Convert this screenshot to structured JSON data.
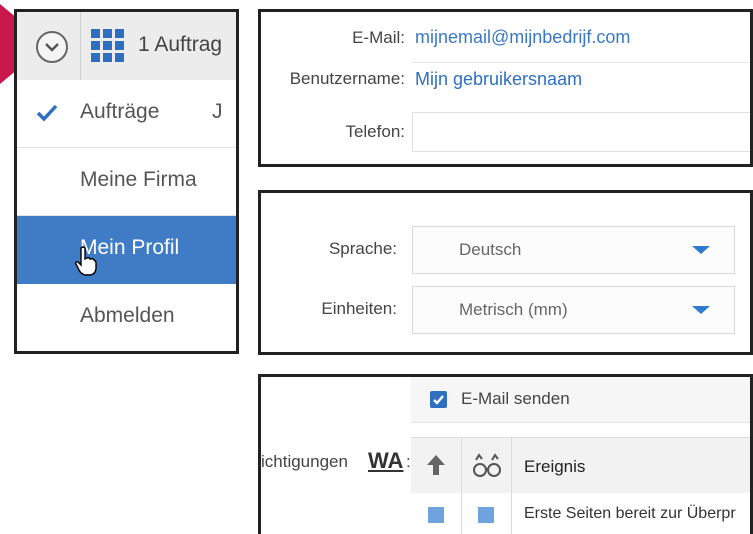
{
  "menu": {
    "top_label": "1 Auftrag",
    "items": [
      {
        "label": "Aufträge",
        "shortcut": "J"
      },
      {
        "label": "Meine Firma"
      },
      {
        "label": "Mein Profil"
      },
      {
        "label": "Abmelden"
      }
    ]
  },
  "profile": {
    "email_label": "E-Mail:",
    "email_value": "mijnemail@mijnbedrijf.com",
    "username_label": "Benutzername:",
    "username_value": "Mijn gebruikersnaam",
    "phone_label": "Telefon:",
    "phone_value": ""
  },
  "prefs": {
    "language_label": "Sprache:",
    "language_value": "Deutsch",
    "units_label": "Einheiten:",
    "units_value": "Metrisch (mm)"
  },
  "notifications": {
    "send_email_label": "E-Mail senden",
    "section_label": "ichtigungen",
    "wa_label": "WA",
    "colon": ":",
    "table_header_event": "Ereignis",
    "row1_event": "Erste Seiten bereit zur Überpr"
  },
  "colors": {
    "accent": "#3f7cc5",
    "pointer": "#c8174a",
    "link": "#3a78c6"
  },
  "icons": [
    "chevron-down-circle-icon",
    "grid-icon",
    "checkmark-icon",
    "hand-cursor-icon",
    "arrow-up-icon",
    "glasses-icon"
  ]
}
